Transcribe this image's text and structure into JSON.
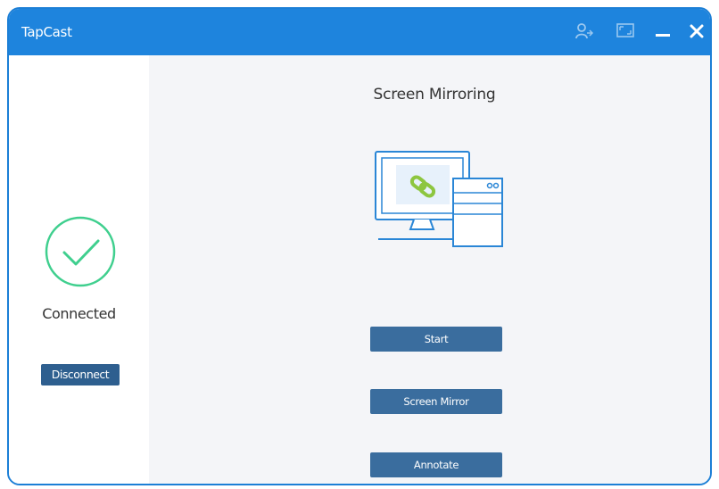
{
  "window": {
    "title": "TapCast",
    "controls": {
      "user_icon": "user-icon",
      "screen_icon": "screen-icon",
      "minimize_icon": "minimize-icon",
      "close_icon": "close-icon"
    }
  },
  "sidebar": {
    "status_icon": "check-circle-icon",
    "status_label": "Connected",
    "disconnect_label": "Disconnect"
  },
  "main": {
    "title": "Screen Mirroring",
    "illustration_icon": "computer-link-icon",
    "buttons": [
      {
        "label": "Start"
      },
      {
        "label": "Screen Mirror"
      },
      {
        "label": "Annotate"
      }
    ]
  },
  "colors": {
    "titlebar": "#1e84dd",
    "accent_green": "#3fcf8e",
    "button_blue": "#3a6d9e",
    "disconnect_blue": "#2e5f8f",
    "illustration_blue": "#2a86d6",
    "link_green": "#8dc63f"
  }
}
